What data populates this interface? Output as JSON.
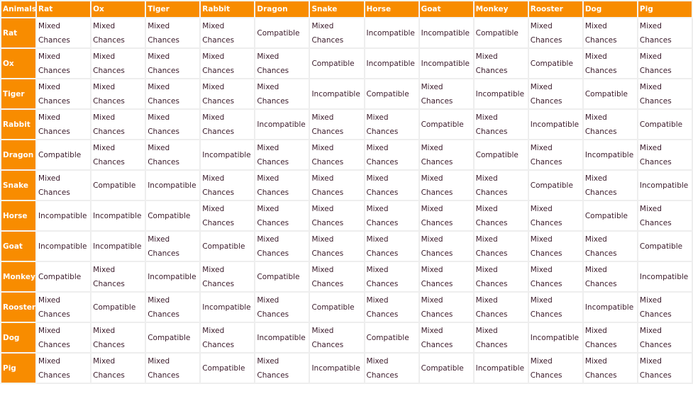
{
  "table": {
    "corner_label": "Animals",
    "columns": [
      "Rat",
      "Ox",
      "Tiger",
      "Rabbit",
      "Dragon",
      "Snake",
      "Horse",
      "Goat",
      "Monkey",
      "Rooster",
      "Dog",
      "Pig"
    ],
    "value_labels": {
      "M": [
        "Mixed",
        "Chances"
      ],
      "C": [
        "Compatible"
      ],
      "I": [
        "Incompatible"
      ]
    },
    "colors": {
      "header_bg": "#f88c00",
      "header_text": "#ffffff",
      "cell_text": "#3a1a2a",
      "border": "#eeeeee"
    },
    "rows": [
      {
        "label": "Rat",
        "cells": [
          "M",
          "M",
          "M",
          "M",
          "C",
          "M",
          "I",
          "I",
          "C",
          "M",
          "M",
          "M"
        ]
      },
      {
        "label": "Ox",
        "cells": [
          "M",
          "M",
          "M",
          "M",
          "M",
          "C",
          "I",
          "I",
          "M",
          "C",
          "M",
          "M"
        ]
      },
      {
        "label": "Tiger",
        "cells": [
          "M",
          "M",
          "M",
          "M",
          "M",
          "I",
          "C",
          "M",
          "I",
          "M",
          "C",
          "M"
        ]
      },
      {
        "label": "Rabbit",
        "cells": [
          "M",
          "M",
          "M",
          "M",
          "I",
          "M",
          "M",
          "C",
          "M",
          "I",
          "M",
          "C"
        ]
      },
      {
        "label": "Dragon",
        "cells": [
          "C",
          "M",
          "M",
          "I",
          "M",
          "M",
          "M",
          "M",
          "C",
          "M",
          "I",
          "M"
        ]
      },
      {
        "label": "Snake",
        "cells": [
          "M",
          "C",
          "I",
          "M",
          "M",
          "M",
          "M",
          "M",
          "M",
          "C",
          "M",
          "I"
        ]
      },
      {
        "label": "Horse",
        "cells": [
          "I",
          "I",
          "C",
          "M",
          "M",
          "M",
          "M",
          "M",
          "M",
          "M",
          "C",
          "M"
        ]
      },
      {
        "label": "Goat",
        "cells": [
          "I",
          "I",
          "M",
          "C",
          "M",
          "M",
          "M",
          "M",
          "M",
          "M",
          "M",
          "C"
        ]
      },
      {
        "label": "Monkey",
        "cells": [
          "C",
          "M",
          "I",
          "M",
          "C",
          "M",
          "M",
          "M",
          "M",
          "M",
          "M",
          "I"
        ]
      },
      {
        "label": "Rooster",
        "cells": [
          "M",
          "C",
          "M",
          "I",
          "M",
          "C",
          "M",
          "M",
          "M",
          "M",
          "I",
          "M"
        ]
      },
      {
        "label": "Dog",
        "cells": [
          "M",
          "M",
          "C",
          "M",
          "I",
          "M",
          "C",
          "M",
          "M",
          "I",
          "M",
          "M"
        ]
      },
      {
        "label": "Pig",
        "cells": [
          "M",
          "M",
          "M",
          "C",
          "M",
          "I",
          "M",
          "C",
          "I",
          "M",
          "M",
          "M"
        ]
      }
    ]
  }
}
